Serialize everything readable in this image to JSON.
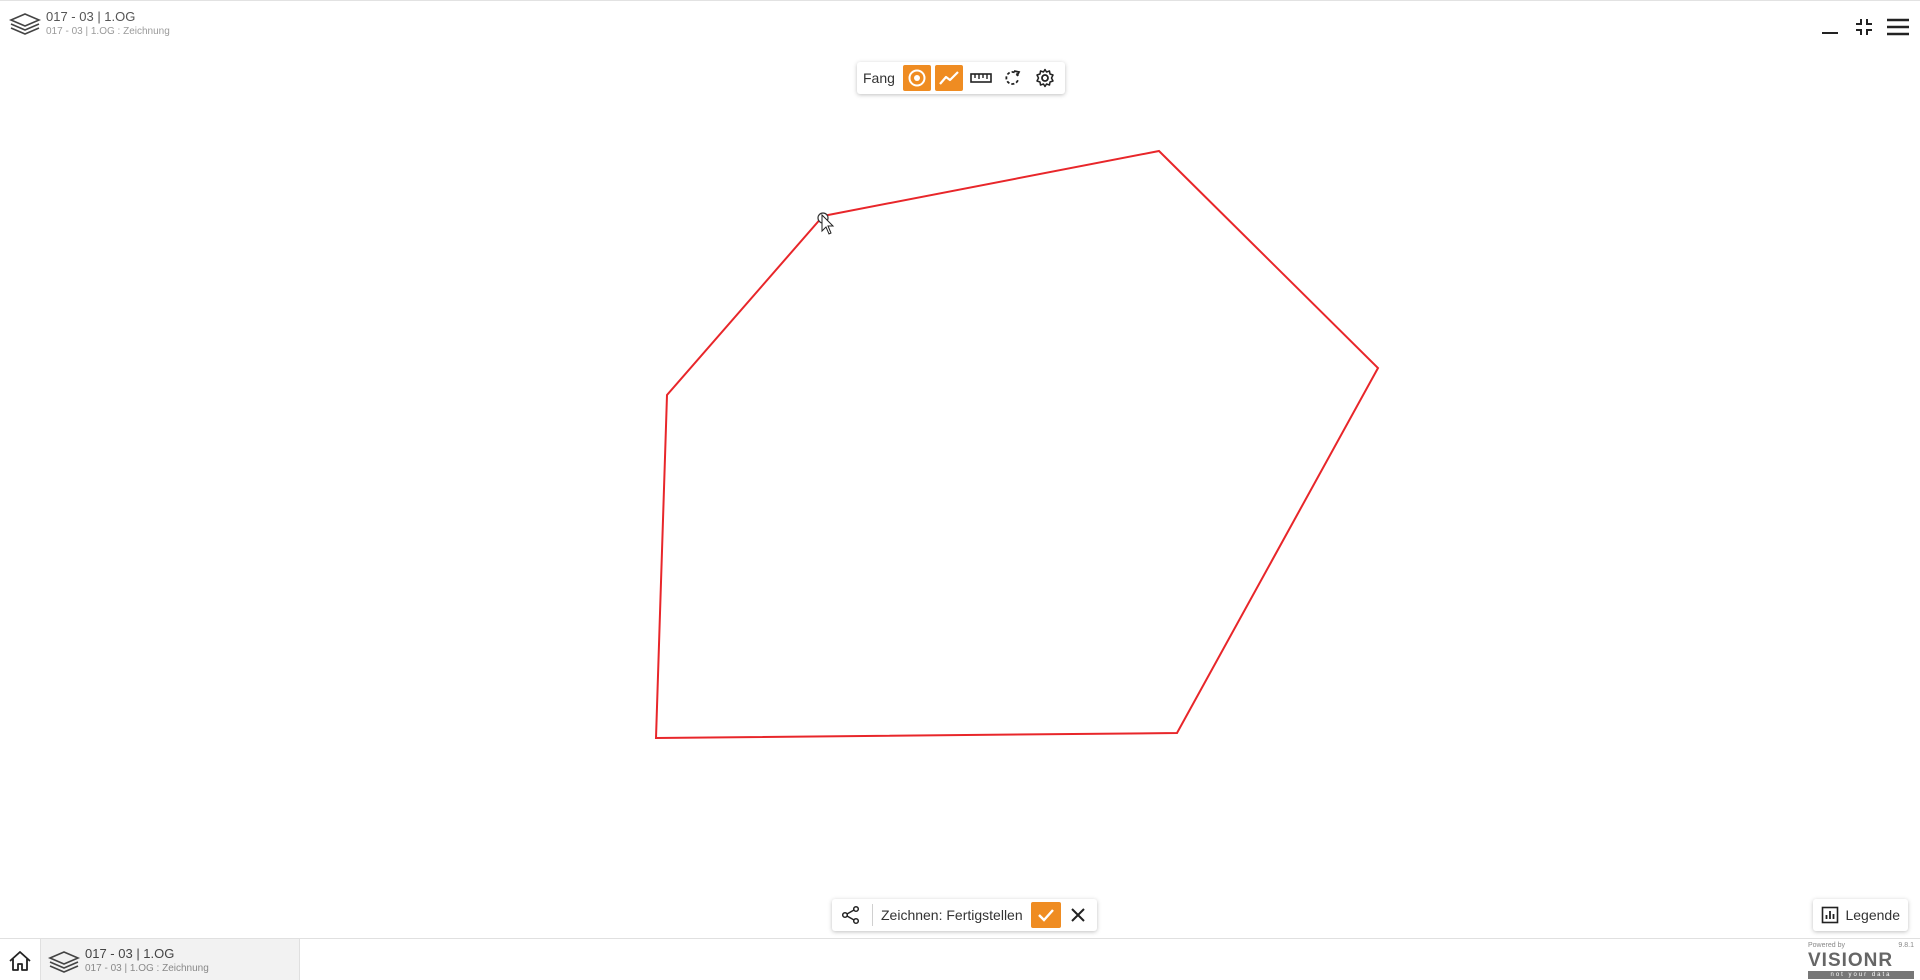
{
  "header": {
    "title": "017 - 03 | 1.OG",
    "subtitle": "017 - 03 | 1.OG : Zeichnung"
  },
  "window_controls": [
    {
      "icon": "minimize-icon"
    },
    {
      "icon": "exit-fullscreen-icon"
    },
    {
      "icon": "menu-icon"
    }
  ],
  "draw_toolbar": {
    "snap_label": "Fang",
    "tools": [
      {
        "icon": "snap-point-icon",
        "active": true
      },
      {
        "icon": "snap-line-icon",
        "active": true
      },
      {
        "icon": "ruler-icon",
        "active": false
      },
      {
        "icon": "rotate-icon",
        "active": false
      },
      {
        "icon": "gear-icon",
        "active": false
      }
    ]
  },
  "drawing": {
    "stroke_color": "#e8262a",
    "vertex_count": 6
  },
  "action_bar": {
    "label": "Zeichnen: Fertigstellen",
    "confirm_icon": "check-icon",
    "cancel_icon": "close-icon",
    "share_icon": "share-icon"
  },
  "legend": {
    "label": "Legende",
    "icon": "chart-icon"
  },
  "bottom_bar": {
    "layer_title": "017 - 03 | 1.OG",
    "layer_subtitle": "017 - 03 | 1.OG : Zeichnung",
    "brand_powered": "Powered by",
    "brand_name": "VISIONR",
    "brand_tagline": "not your data",
    "version": "9.8.1"
  },
  "colors": {
    "accent": "#ef8c22",
    "polygon": "#e8262a"
  }
}
